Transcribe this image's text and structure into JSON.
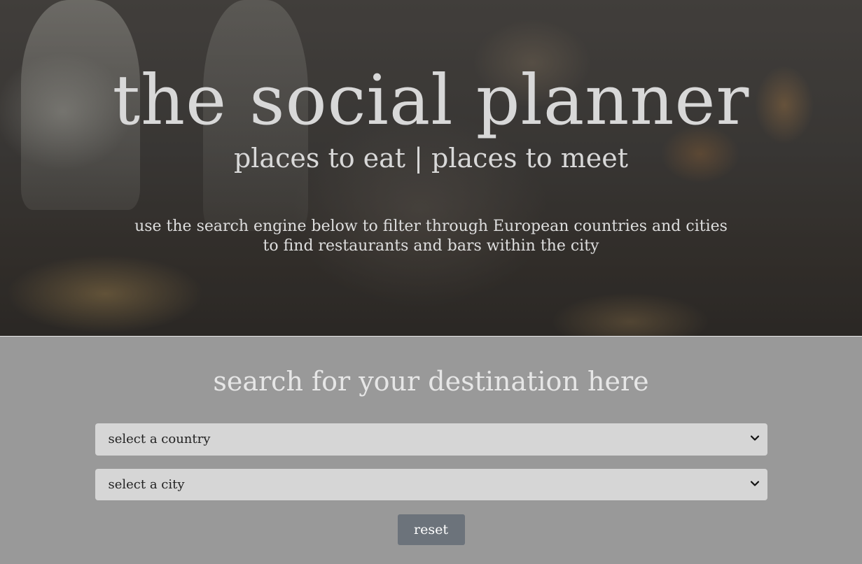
{
  "hero": {
    "title": "the social planner",
    "subtitle": "places to eat | places to meet",
    "description_line1": "use the search engine below to filter through European countries and cities",
    "description_line2": "to find restaurants and bars within the city"
  },
  "search": {
    "heading": "search for your destination here",
    "country_select": {
      "selected": "select a country"
    },
    "city_select": {
      "selected": "select a city"
    },
    "reset_label": "reset"
  },
  "colors": {
    "search_background": "#999999",
    "select_background": "#d6d6d6",
    "reset_button": "#6c737b",
    "hero_text": "#d8d8d8"
  },
  "icons": {
    "dropdown": "chevron-down-icon"
  }
}
